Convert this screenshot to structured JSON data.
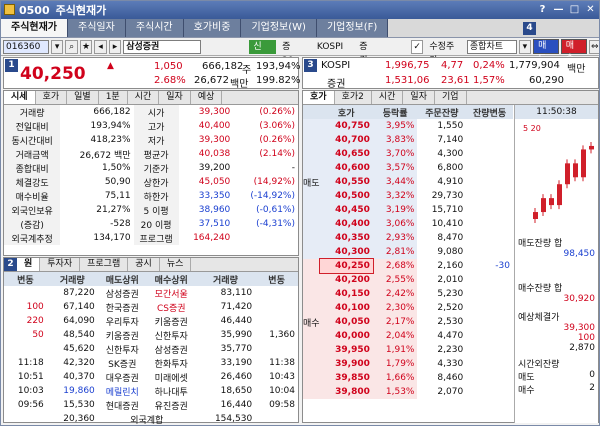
{
  "window": {
    "code": "0500",
    "title": "주식현재가",
    "help_icon": "?"
  },
  "tabs": [
    "주식현재가",
    "주식일자",
    "주식시간",
    "호가비중",
    "기업정보(W)",
    "기업정보(F)"
  ],
  "toolbar": {
    "code": "016360",
    "name": "삼성증권",
    "badge1": "신45",
    "badge2": "증20",
    "market": "KOSPI",
    "sector": "증권",
    "modify_label": "수정주가",
    "chart": "종합차트",
    "sell": "매도",
    "buy": "매수"
  },
  "panel_nums": [
    "1",
    "2",
    "3",
    "4"
  ],
  "quote": {
    "price": "40,250",
    "change": "1,050",
    "change_pct": "2.68%",
    "volume": "666,182",
    "volume_unit": "주",
    "vol_ratio": "193,94%",
    "amount": "26,672",
    "amount_unit": "백만",
    "amount_ratio": "199.82%"
  },
  "sub_tabs": [
    "시세",
    "호가",
    "일별",
    "1분",
    "시간",
    "일자",
    "예상"
  ],
  "info_rows": [
    [
      "거래량",
      "666,182",
      "시가",
      "39,300",
      "(0.26%)"
    ],
    [
      "전일대비",
      "193,94%",
      "고가",
      "40,400",
      "(3.06%)"
    ],
    [
      "동시간대비",
      "418,23%",
      "저가",
      "39,300",
      "(0.26%)"
    ],
    [
      "거래금액",
      "26,672 백만",
      "평균가",
      "40,038",
      "(2.14%)"
    ],
    [
      "종합대비",
      "1,50%",
      "기준가",
      "39,200",
      "-"
    ],
    [
      "체결강도",
      "50,90",
      "상한가",
      "45,050",
      "(14,92%)"
    ],
    [
      "매수비율",
      "75,11",
      "하한가",
      "33,350",
      "(-14,92%)"
    ],
    [
      "외국인보유",
      "21,27%",
      "5 이평",
      "38,960",
      "(-0,61%)"
    ],
    [
      "(증감)",
      "-528",
      "20 이평",
      "37,510",
      "(-4,31%)"
    ],
    [
      "외국계추정",
      "134,170",
      "프로그램",
      "164,240",
      ""
    ]
  ],
  "broker_tabs": [
    "원",
    "투자자",
    "프로그램",
    "공시",
    "뉴스"
  ],
  "broker_headers": [
    "변동",
    "거래량",
    "매도상위",
    "매수상위",
    "거래량",
    "변동"
  ],
  "broker_rows": [
    [
      "",
      "87,220",
      "삼성증권",
      "모간서울",
      "83,110",
      ""
    ],
    [
      "100",
      "67,140",
      "한국증권",
      "CS증권",
      "71,420",
      ""
    ],
    [
      "220",
      "64,090",
      "우리투자",
      "키움증권",
      "46,440",
      ""
    ],
    [
      "50",
      "48,540",
      "키움증권",
      "신한투자",
      "35,990",
      "1,360"
    ],
    [
      "",
      "45,620",
      "신한투자",
      "삼성증권",
      "35,770",
      ""
    ],
    [
      "11:18",
      "42,320",
      "SK증권",
      "한화투자",
      "33,190",
      "11:38"
    ],
    [
      "10:51",
      "40,370",
      "대우증권",
      "미래에셋",
      "26,460",
      "10:43"
    ],
    [
      "10:03",
      "19,860",
      "메릴린치",
      "하나대투",
      "18,650",
      "10:04"
    ],
    [
      "09:56",
      "15,530",
      "현대증권",
      "유진증권",
      "16,440",
      "09:58"
    ]
  ],
  "broker_total": {
    "left": "20,360",
    "label": "외국계합",
    "right": "154,530"
  },
  "index": {
    "name": "KOSPI",
    "value": "1,996,75",
    "change": "4,77",
    "pct": "0,24%",
    "amount": "1,779,904",
    "unit": "백만",
    "sector": "증권",
    "s_value": "1,531,06",
    "s_change": "23,61",
    "s_pct": "1,57%",
    "s_amount": "60,290"
  },
  "order_tabs": [
    "호가",
    "호가2",
    "시간",
    "일자",
    "기업"
  ],
  "order_headers": [
    "호가",
    "등락률",
    "주문잔량",
    "잔량변동",
    "11:50:38"
  ],
  "asks": [
    [
      "40,750",
      "3,95%",
      "1,550"
    ],
    [
      "40,700",
      "3,83%",
      "7,140"
    ],
    [
      "40,650",
      "3,70%",
      "4,300"
    ],
    [
      "40,600",
      "3,57%",
      "6,800"
    ],
    [
      "40,550",
      "3,44%",
      "4,910"
    ],
    [
      "40,500",
      "3,32%",
      "29,730"
    ],
    [
      "40,450",
      "3,19%",
      "15,710"
    ],
    [
      "40,400",
      "3,06%",
      "10,410"
    ],
    [
      "40,350",
      "2,93%",
      "8,470"
    ],
    [
      "40,300",
      "2,81%",
      "9,080"
    ]
  ],
  "bids": [
    [
      "40,250",
      "2,68%",
      "2,160",
      "-30"
    ],
    [
      "40,200",
      "2,55%",
      "2,010",
      ""
    ],
    [
      "40,150",
      "2,42%",
      "5,230",
      ""
    ],
    [
      "40,100",
      "2,30%",
      "2,520",
      ""
    ],
    [
      "40,050",
      "2,17%",
      "2,530",
      ""
    ],
    [
      "40,000",
      "2,04%",
      "4,470",
      ""
    ],
    [
      "39,950",
      "1,91%",
      "2,230",
      ""
    ],
    [
      "39,900",
      "1,79%",
      "4,330",
      ""
    ],
    [
      "39,850",
      "1,66%",
      "8,460",
      ""
    ],
    [
      "39,800",
      "1,53%",
      "2,070",
      ""
    ]
  ],
  "side": {
    "ask_label": "매도",
    "bid_label": "매수",
    "ask_total_label": "매도잔량 합",
    "ask_total": "98,450",
    "bid_total_label": "매수잔량 합",
    "bid_total": "30,920",
    "expected_label": "예상체결가",
    "expected": "39,300",
    "exp_qty": "100",
    "exp_qty2": "2,870",
    "after_label": "시간외잔량",
    "after_sell": "매도",
    "after_sell_v": "0",
    "after_buy": "매수",
    "after_buy_v": "2",
    "chart_hint": "5  20"
  },
  "chart_data": {
    "type": "candlestick",
    "values": [
      39.3,
      39.5,
      39.4,
      39.7,
      40.0,
      39.8,
      40.2,
      40.25
    ]
  }
}
